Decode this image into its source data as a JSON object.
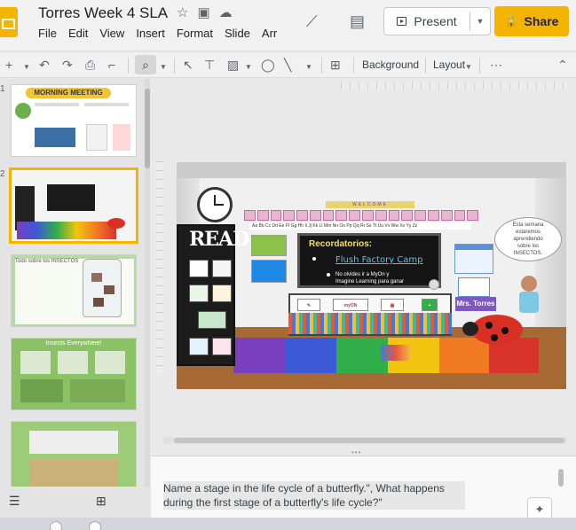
{
  "header": {
    "doc_title": "Torres Week 4 SLA",
    "menu": [
      "File",
      "Edit",
      "View",
      "Insert",
      "Format",
      "Slide",
      "Arr"
    ],
    "present_label": "Present",
    "share_label": "Share"
  },
  "toolbar": {
    "background_label": "Background",
    "layout_label": "Layout"
  },
  "filmstrip": {
    "slide_numbers": [
      "1",
      "2"
    ],
    "thumb1_title": "MORNING MEETING",
    "thumb3_title": "Todo sobre los INSECTOS",
    "thumb4_title": "Insects Everywhere!"
  },
  "slide": {
    "welcome": "WELCOME",
    "alphabet": "Aa Bb Cc Dd Ee Ff Gg Hh Ii Jj Kk Ll Mm Nn Oo Pp Qq Rr Ss Tt Uu Vv Ww Xx Yy Zz",
    "read_sign": "READ",
    "board_title": "Recordatorios:",
    "board_link": "Flush Factory Camp",
    "board_bullet_1": "No olvides ir a MyOn y",
    "board_bullet_2": "Imagine Learning para ganar",
    "myon_label": "myON",
    "teacher_name": "Mrs. Torres",
    "speech_lines": [
      "Esta semana",
      "estaremos",
      "aprendiendo",
      "sobre los",
      "INSECTOS."
    ]
  },
  "notes": {
    "text": "Name a stage in the life cycle of a butterfly.\", What happens during the first stage of a butterfly's life cycle?\""
  },
  "colors": {
    "accent": "#f4b400",
    "rug": [
      "#7a3fbf",
      "#3d5ad6",
      "#2fae4a",
      "#f1c40f",
      "#f07b23",
      "#d9342b"
    ]
  }
}
